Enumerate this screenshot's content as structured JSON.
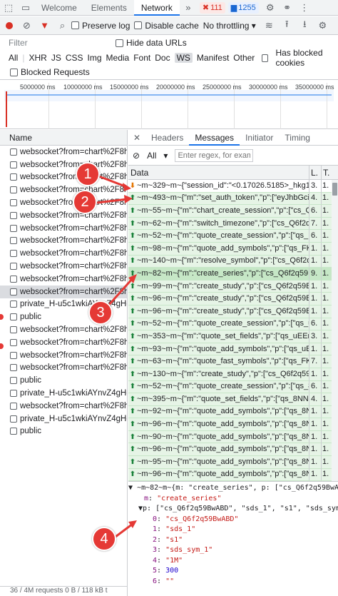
{
  "topbar": {
    "tabs": [
      "Welcome",
      "Elements",
      "Network"
    ],
    "active_tab": "Network",
    "errors": "111",
    "messages": "1255"
  },
  "toolbar": {
    "preserve_log": "Preserve log",
    "disable_cache": "Disable cache",
    "throttling": "No throttling"
  },
  "filter": {
    "placeholder": "Filter",
    "hide_data_urls": "Hide data URLs",
    "types": [
      "All",
      "XHR",
      "JS",
      "CSS",
      "Img",
      "Media",
      "Font",
      "Doc",
      "WS",
      "Manifest",
      "Other"
    ],
    "selected_type": "WS",
    "has_blocked_cookies": "Has blocked cookies",
    "blocked_requests": "Blocked Requests"
  },
  "overview": {
    "ticks": [
      "5000000 ms",
      "10000000 ms",
      "15000000 ms",
      "20000000 ms",
      "25000000 ms",
      "30000000 ms",
      "35000000 ms"
    ]
  },
  "left": {
    "header": "Name",
    "rows": [
      "websocket?from=chart%2F8h...",
      "websocket?from=chart%2F8h...",
      "websocket?from=chart%2F8h...",
      "websocket?from=chart%2F8h...",
      "websocket?from=chart%2F8h...",
      "websocket?from=chart%2F8h...",
      "websocket?from=chart%2F8h...",
      "websocket?from=chart%2F8h...",
      "websocket?from=chart%2F8h...",
      "websocket?from=chart%2F8h...",
      "websocket?from=chart%2F8h...",
      "websocket?from=chart%2F8h...",
      "private_H-u5c1wkiAYnvZ4gHd...",
      "public",
      "websocket?from=chart%2F8h...",
      "websocket?from=chart%2F8h...",
      "websocket?from=chart%2F8h...",
      "websocket?from=chart%2F8h...",
      "public",
      "private_H-u5c1wkiAYnvZ4gHd...",
      "websocket?from=chart%2F8h...",
      "private_H-u5c1wkiAYnvZ4gHd...",
      "public"
    ],
    "selected_index": 11,
    "footer": "36 / 4M requests  0 B / 118 kB t"
  },
  "right": {
    "tabs": [
      "Headers",
      "Messages",
      "Initiator",
      "Timing"
    ],
    "active_tab": "Messages",
    "filter_select": "All",
    "filter_placeholder": "Enter regex, for exam",
    "col_data": "Data",
    "col_len": "L.",
    "col_time": "T.",
    "messages": [
      {
        "dir": "recv",
        "data": "~m~329~m~{\"session_id\":\"<0.17026.5185>_hkg1-...",
        "len": "3.",
        "time": "1."
      },
      {
        "dir": "sent",
        "data": "~m~493~m~{\"m\":\"set_auth_token\",\"p\":[\"eyJhbGci...",
        "len": "4.",
        "time": "1."
      },
      {
        "dir": "sent",
        "data": "~m~55~m~{\"m\":\"chart_create_session\",\"p\":[\"cs_Q6...",
        "len": "6.",
        "time": "1."
      },
      {
        "dir": "sent",
        "data": "~m~62~m~{\"m\":\"switch_timezone\",\"p\":[\"cs_Q6f2q...",
        "len": "7.",
        "time": "1."
      },
      {
        "dir": "sent",
        "data": "~m~52~m~{\"m\":\"quote_create_session\",\"p\":[\"qs_FK...",
        "len": "6.",
        "time": "1."
      },
      {
        "dir": "sent",
        "data": "~m~98~m~{\"m\":\"quote_add_symbols\",\"p\":[\"qs_FKY...",
        "len": "1.",
        "time": "1."
      },
      {
        "dir": "sent",
        "data": "~m~140~m~{\"m\":\"resolve_symbol\",\"p\":[\"cs_Q6f2q...",
        "len": "1.",
        "time": "1."
      },
      {
        "dir": "sent",
        "data": "~m~82~m~{\"m\":\"create_series\",\"p\":[\"cs_Q6f2q59B...",
        "len": "9.",
        "time": "1."
      },
      {
        "dir": "sent",
        "data": "~m~99~m~{\"m\":\"create_study\",\"p\":[\"cs_Q6f2q59B...",
        "len": "1.",
        "time": "1."
      },
      {
        "dir": "sent",
        "data": "~m~96~m~{\"m\":\"create_study\",\"p\":[\"cs_Q6f2q59B...",
        "len": "1.",
        "time": "1."
      },
      {
        "dir": "sent",
        "data": "~m~96~m~{\"m\":\"create_study\",\"p\":[\"cs_Q6f2q59B...",
        "len": "1.",
        "time": "1."
      },
      {
        "dir": "sent",
        "data": "~m~52~m~{\"m\":\"quote_create_session\",\"p\":[\"qs_uE...",
        "len": "6.",
        "time": "1."
      },
      {
        "dir": "sent",
        "data": "~m~353~m~{\"m\":\"quote_set_fields\",\"p\":[\"qs_uEEn...",
        "len": "3.",
        "time": "1."
      },
      {
        "dir": "sent",
        "data": "~m~93~m~{\"m\":\"quote_add_symbols\",\"p\":[\"qs_uEEn...",
        "len": "1.",
        "time": "1."
      },
      {
        "dir": "sent",
        "data": "~m~63~m~{\"m\":\"quote_fast_symbols\",\"p\":[\"qs_FK...",
        "len": "7.",
        "time": "1."
      },
      {
        "dir": "sent",
        "data": "~m~130~m~{\"m\":\"create_study\",\"p\":[\"cs_Q6f2q59B...",
        "len": "1.",
        "time": "1."
      },
      {
        "dir": "sent",
        "data": "~m~52~m~{\"m\":\"quote_create_session\",\"p\":[\"qs_8N...",
        "len": "6.",
        "time": "1."
      },
      {
        "dir": "sent",
        "data": "~m~395~m~{\"m\":\"quote_set_fields\",\"p\":[\"qs_8NN...",
        "len": "4.",
        "time": "1."
      },
      {
        "dir": "sent",
        "data": "~m~92~m~{\"m\":\"quote_add_symbols\",\"p\":[\"qs_8N...",
        "len": "1.",
        "time": "1."
      },
      {
        "dir": "sent",
        "data": "~m~96~m~{\"m\":\"quote_add_symbols\",\"p\":[\"qs_8N...",
        "len": "1.",
        "time": "1."
      },
      {
        "dir": "sent",
        "data": "~m~90~m~{\"m\":\"quote_add_symbols\",\"p\":[\"qs_8N...",
        "len": "1.",
        "time": "1."
      },
      {
        "dir": "sent",
        "data": "~m~96~m~{\"m\":\"quote_add_symbols\",\"p\":[\"qs_8N...",
        "len": "1.",
        "time": "1."
      },
      {
        "dir": "sent",
        "data": "~m~95~m~{\"m\":\"quote_add_symbols\",\"p\":[\"qs_8N...",
        "len": "1.",
        "time": "1."
      },
      {
        "dir": "sent",
        "data": "~m~96~m~{\"m\":\"quote_add_symbols\",\"p\":[\"qs_8N...",
        "len": "1.",
        "time": "1."
      }
    ],
    "selected_message": 7,
    "detail": {
      "summary": "~m~82~m~{m: \"create_series\", p: [\"cs_Q6f2q59BwABD\"",
      "m_key": "m",
      "m_value": "\"create_series\"",
      "p_summary": "p: [\"cs_Q6f2q59BwABD\", \"sds_1\", \"s1\", \"sds_sym_1\"",
      "p_items": [
        {
          "k": "0",
          "v": "\"cs_Q6f2q59BwABD\"",
          "kind": "s"
        },
        {
          "k": "1",
          "v": "\"sds_1\"",
          "kind": "s"
        },
        {
          "k": "2",
          "v": "\"s1\"",
          "kind": "s"
        },
        {
          "k": "3",
          "v": "\"sds_sym_1\"",
          "kind": "s"
        },
        {
          "k": "4",
          "v": "\"1M\"",
          "kind": "s"
        },
        {
          "k": "5",
          "v": "300",
          "kind": "n"
        },
        {
          "k": "6",
          "v": "\"\"",
          "kind": "s"
        }
      ]
    }
  },
  "callouts": [
    "1",
    "2",
    "3",
    "4"
  ],
  "colors": {
    "accent": "#1a73e8",
    "callout": "#e53935",
    "sent_bg": "#e6f4e6",
    "selected_bg": "#c6e7c6"
  }
}
